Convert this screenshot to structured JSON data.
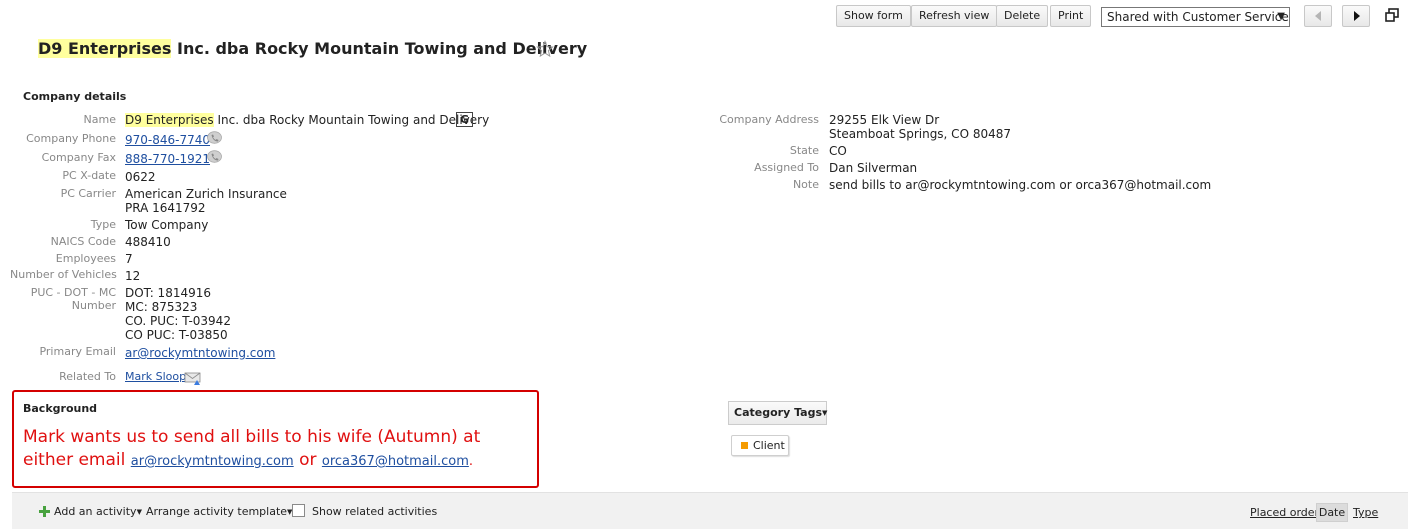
{
  "toolbar": {
    "show_form": "Show form",
    "refresh_view": "Refresh view",
    "delete": "Delete",
    "print": "Print",
    "sharing_select": "Shared with Customer Service"
  },
  "record": {
    "title_highlight": "D9 Enterprises",
    "title_rest": " Inc. dba Rocky Mountain Towing and Delivery"
  },
  "company_details": {
    "heading": "Company details",
    "name_label": "Name",
    "name_highlight": "D9 Enterprises",
    "name_rest": " Inc. dba Rocky Mountain Towing and Delivery",
    "google_icon": "G",
    "phone_label": "Company Phone",
    "phone": "970-846-7740",
    "fax_label": "Company Fax",
    "fax": "888-770-1921",
    "pc_xdate_label": "PC X-date",
    "pc_xdate": "0622",
    "pc_carrier_label": "PC Carrier",
    "pc_carrier_line1": "American Zurich Insurance",
    "pc_carrier_line2": "PRA 1641792",
    "type_label": "Type",
    "type": "Tow Company",
    "naics_label": "NAICS Code",
    "naics": "488410",
    "employees_label": "Employees",
    "employees": "7",
    "vehicles_label": "Number of Vehicles",
    "vehicles": "12",
    "puc_label_line1": "PUC - DOT - MC",
    "puc_label_line2": "Number",
    "puc_line1": "DOT: 1814916",
    "puc_line2": "MC: 875323",
    "puc_line3": "CO. PUC: T-03942",
    "puc_line4": "CO PUC: T-03850",
    "email_label": "Primary Email",
    "email": "ar@rockymtntowing.com",
    "related_label": "Related To",
    "related": "Mark Sloop",
    "address_label": "Company Address",
    "address_line1": "29255 Elk View Dr",
    "address_line2": "Steamboat Springs, CO 80487",
    "state_label": "State",
    "state": "CO",
    "assigned_label": "Assigned To",
    "assigned": "Dan Silverman",
    "note_label": "Note",
    "note": "send bills to ar@rockymtntowing.com or orca367@hotmail.com"
  },
  "background": {
    "heading": "Background",
    "text1": "Mark wants us to send all bills to his wife (Autumn) at either email ",
    "link1": "ar@rockymtntowing.com",
    "text2": " or ",
    "link2": "orca367@hotmail.com",
    "text3": "."
  },
  "category_tags": {
    "button": "Category Tags",
    "tag": "Client",
    "tag_color": "#f59b00"
  },
  "activity_bar": {
    "add_activity": "Add an activity",
    "arrange_template": "Arrange activity template",
    "show_related": "Show related activities",
    "placed_order": "Placed order",
    "date": "Date",
    "type": "Type"
  }
}
